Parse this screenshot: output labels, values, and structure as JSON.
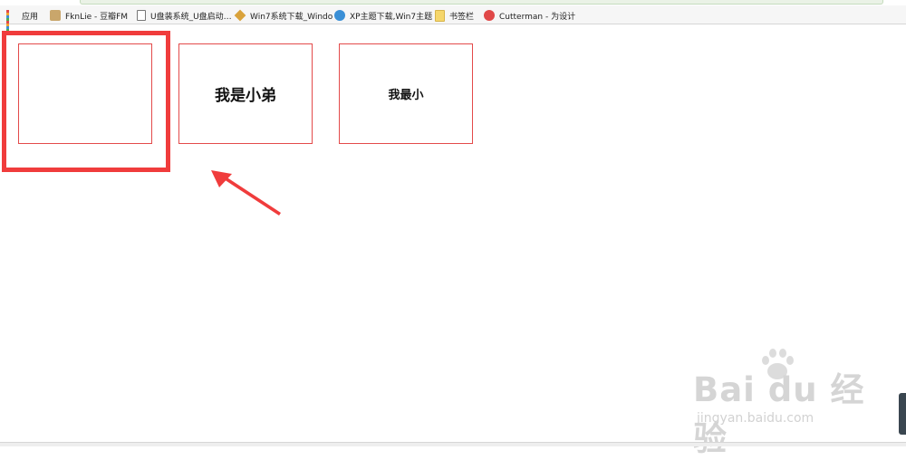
{
  "bookmarks_bar": {
    "items": [
      {
        "label": "应用",
        "icon": "apps-icon"
      },
      {
        "label": "FknLie - 豆瓣FM",
        "icon": "fm-icon"
      },
      {
        "label": "U盘装系统_U盘启动…",
        "icon": "page-icon"
      },
      {
        "label": "Win7系统下载_Windo",
        "icon": "windows-icon"
      },
      {
        "label": "XP主题下载,Win7主题",
        "icon": "ie-icon"
      },
      {
        "label": "书签栏",
        "icon": "folder-icon"
      },
      {
        "label": "Cutterman - 为设计",
        "icon": "cutterman-icon"
      }
    ]
  },
  "boxes": [
    {
      "text": "",
      "font_size": "16px"
    },
    {
      "text": "我是小弟",
      "font_size": "17px"
    },
    {
      "text": "我最小",
      "font_size": "13px"
    }
  ],
  "watermark": {
    "main": "Bai du 经验",
    "sub": "jingyan.baidu.com"
  },
  "colors": {
    "box_border": "#e34a4a",
    "highlight": "#f03c3c",
    "arrow": "#f03c3c"
  }
}
